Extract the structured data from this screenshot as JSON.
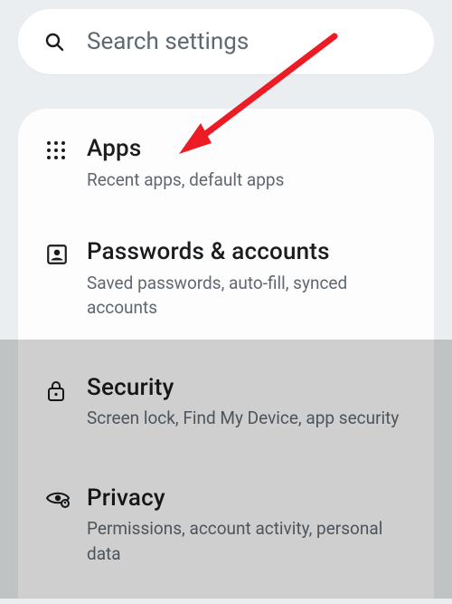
{
  "search": {
    "placeholder": "Search settings"
  },
  "items": [
    {
      "title": "Apps",
      "subtitle": "Recent apps, default apps"
    },
    {
      "title": "Passwords & accounts",
      "subtitle": "Saved passwords, auto-fill, synced accounts"
    },
    {
      "title": "Security",
      "subtitle": "Screen lock, Find My Device, app security"
    },
    {
      "title": "Privacy",
      "subtitle": "Permissions, account activity, personal data"
    }
  ]
}
